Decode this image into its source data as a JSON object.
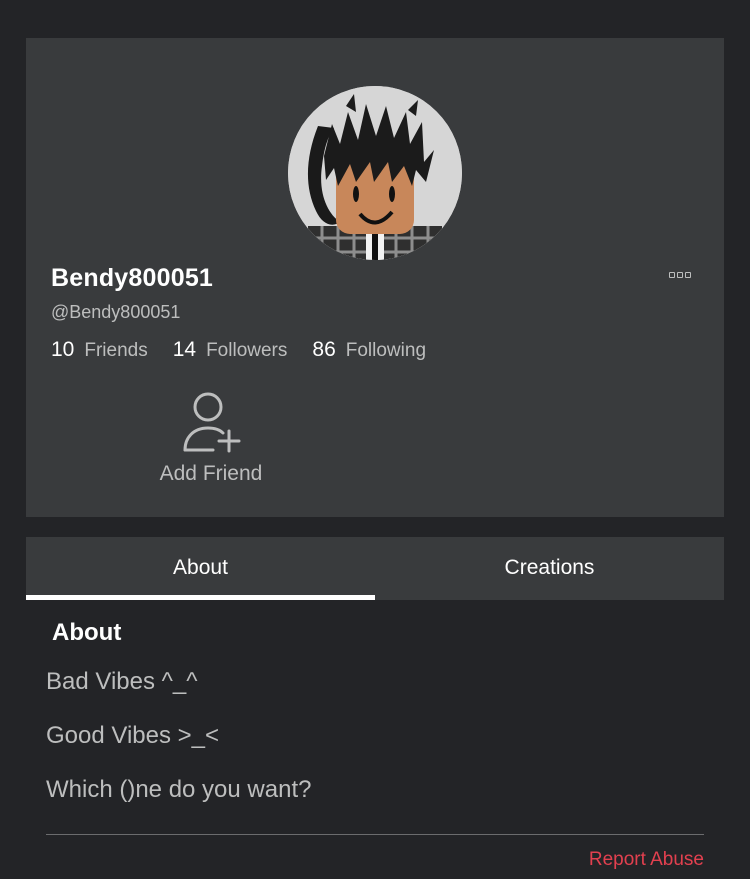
{
  "profile": {
    "display_name": "Bendy800051",
    "username": "@Bendy800051",
    "stats": [
      {
        "count": "10",
        "label": "Friends"
      },
      {
        "count": "14",
        "label": "Followers"
      },
      {
        "count": "86",
        "label": "Following"
      }
    ],
    "add_friend_label": "Add Friend",
    "more_icon": "more-options-icon",
    "add_friend_icon": "person-plus-icon"
  },
  "tabs": [
    {
      "label": "About",
      "active": true
    },
    {
      "label": "Creations",
      "active": false
    }
  ],
  "about": {
    "heading": "About",
    "lines": [
      "Bad Vibes ^_^",
      "Good Vibes >_<",
      "Which ()ne do you want?"
    ]
  },
  "footer": {
    "report_label": "Report Abuse"
  },
  "colors": {
    "background": "#232427",
    "card": "#393b3d",
    "text_primary": "#ffffff",
    "text_secondary": "#bdbebe",
    "report": "#e2404f"
  }
}
